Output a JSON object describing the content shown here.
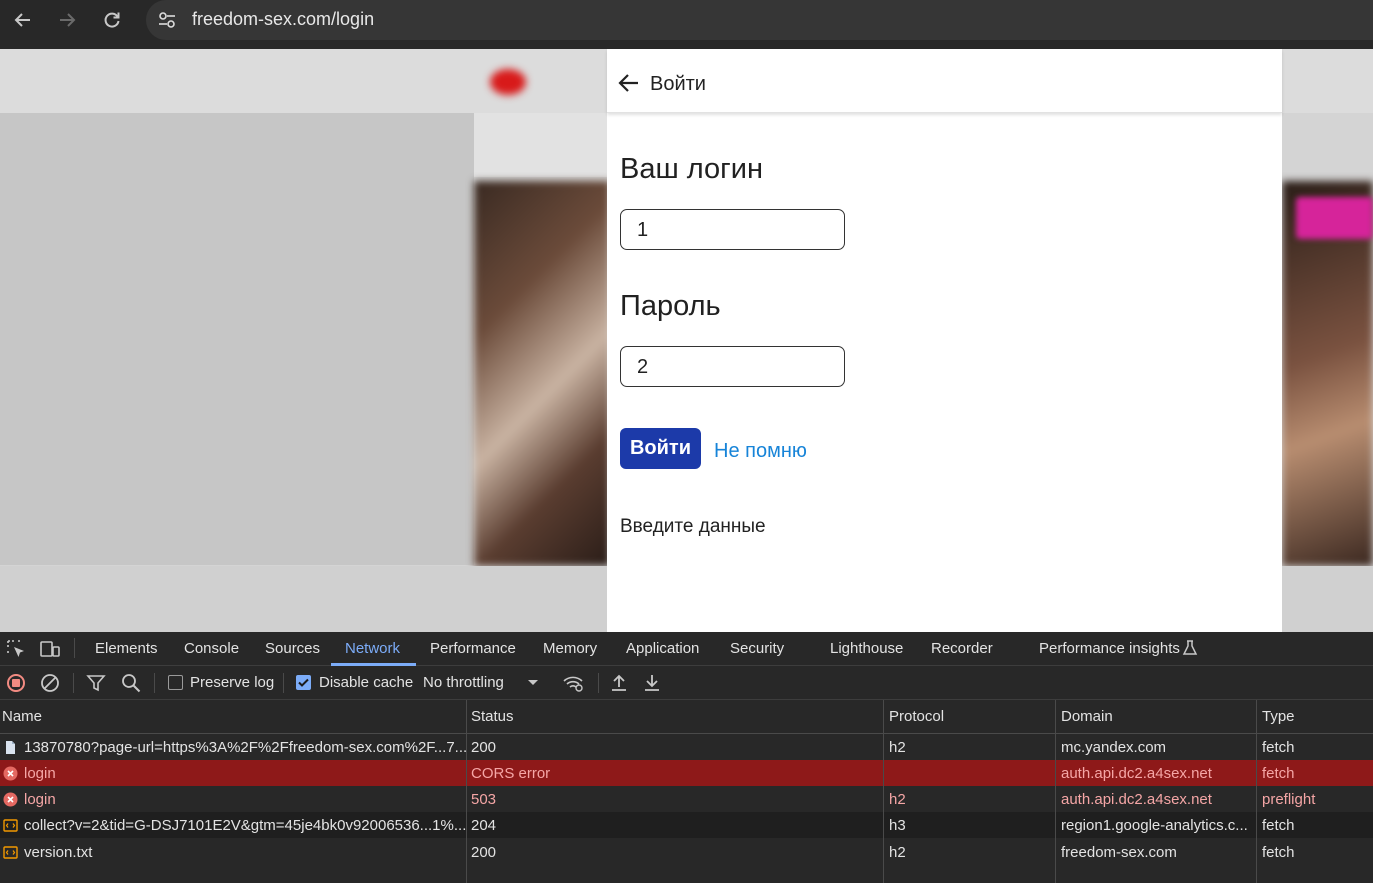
{
  "browser": {
    "url": "freedom-sex.com/login"
  },
  "login": {
    "back_title": "Войти",
    "login_label": "Ваш логин",
    "login_value": "1",
    "password_label": "Пароль",
    "password_value": "2",
    "submit_label": "Войти",
    "forgot_label": "Не помню",
    "hint": "Введите данные"
  },
  "devtools": {
    "tabs": [
      "Elements",
      "Console",
      "Sources",
      "Network",
      "Performance",
      "Memory",
      "Application",
      "Security",
      "Lighthouse",
      "Recorder",
      "Performance insights"
    ],
    "active_tab": "Network",
    "toolbar": {
      "preserve_log": "Preserve log",
      "preserve_log_checked": false,
      "disable_cache": "Disable cache",
      "disable_cache_checked": true,
      "throttling": "No throttling"
    },
    "columns": [
      "Name",
      "Status",
      "Protocol",
      "Domain",
      "Type"
    ],
    "rows": [
      {
        "name": "13870780?page-url=https%3A%2F%2Ffreedom-sex.com%2F...7...",
        "status": "200",
        "protocol": "h2",
        "domain": "mc.yandex.com",
        "type": "fetch",
        "icon": "document-icon"
      },
      {
        "name": "login",
        "status": "CORS error",
        "protocol": "",
        "domain": "auth.api.dc2.a4sex.net",
        "type": "fetch",
        "icon": "error-icon"
      },
      {
        "name": "login",
        "status": "503",
        "protocol": "h2",
        "domain": "auth.api.dc2.a4sex.net",
        "type": "preflight",
        "icon": "error-icon"
      },
      {
        "name": "collect?v=2&tid=G-DSJ7101E2V&gtm=45je4bk0v92006536...1%...",
        "status": "204",
        "protocol": "h3",
        "domain": "region1.google-analytics.c...",
        "type": "fetch",
        "icon": "fetch-icon"
      },
      {
        "name": "version.txt",
        "status": "200",
        "protocol": "h2",
        "domain": "freedom-sex.com",
        "type": "fetch",
        "icon": "fetch-icon"
      }
    ]
  },
  "colors": {
    "primary_button": "#1c3aa9",
    "link": "#1784d8",
    "error_row": "#8e1919",
    "devtools_accent": "#7cacf8"
  }
}
